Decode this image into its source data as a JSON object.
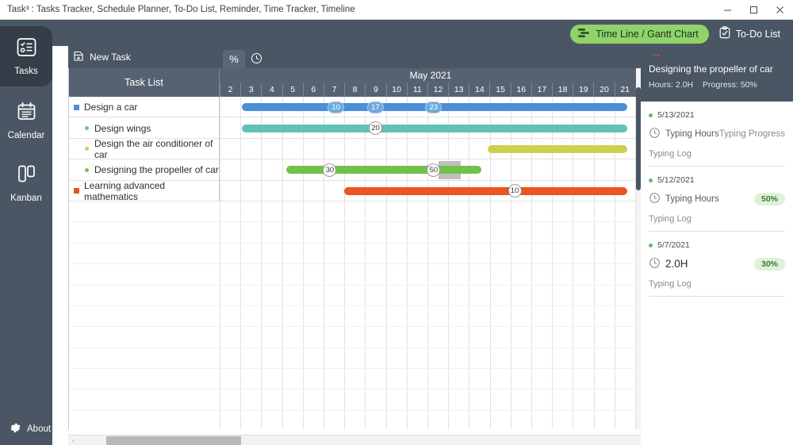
{
  "window": {
    "title": "Task³ : Tasks Tracker, Schedule Planner, To-Do List, Reminder, Time Tracker, Timeline",
    "minimize_icon": "minimize-icon",
    "maximize_icon": "maximize-icon",
    "close_icon": "close-icon"
  },
  "top_actions": {
    "gantt_label": "Time Line / Gantt Chart",
    "gantt_icon": "timeline-icon",
    "gantt_bg": "#8fd36a",
    "todo_label": "To-Do List",
    "todo_icon": "clipboard-check-icon"
  },
  "sidebar": {
    "items": [
      {
        "label": "Tasks",
        "icon": "tasks-checklist-icon",
        "active": true
      },
      {
        "label": "Calendar",
        "icon": "calendar-icon",
        "active": false
      },
      {
        "label": "Kanban",
        "icon": "kanban-columns-icon",
        "active": false
      }
    ],
    "about_label": "About",
    "about_icon": "gear-icon"
  },
  "toolbar": {
    "new_task_label": "New Task",
    "new_task_icon": "add-document-icon",
    "tabs": [
      {
        "glyph": "%",
        "name": "percent-tab",
        "selected": true
      },
      {
        "glyph": "clock",
        "name": "clock-tab",
        "selected": false
      }
    ]
  },
  "gantt": {
    "tasklist_header": "Task List",
    "month_header": "May 2021",
    "days": [
      "2",
      "3",
      "4",
      "5",
      "6",
      "7",
      "8",
      "9",
      "10",
      "11",
      "12",
      "13",
      "14",
      "15",
      "16",
      "17",
      "18",
      "19",
      "20",
      "21"
    ],
    "tasks": [
      {
        "name": "Design a car",
        "level": 0,
        "color": "#4a90d9",
        "bullet": "square"
      },
      {
        "name": "Design wings",
        "level": 1,
        "color": "#5fc2b4",
        "bullet": "dot"
      },
      {
        "name": "Design the air conditioner of car",
        "level": 1,
        "color": "#cdd04e",
        "bullet": "dot"
      },
      {
        "name": "Designing the propeller of car",
        "level": 1,
        "color": "#6fc24a",
        "bullet": "dot"
      },
      {
        "name": "Learning advanced mathematics",
        "level": 0,
        "color": "#ea5520",
        "bullet": "square"
      }
    ],
    "bars": [
      {
        "task": "Design a car",
        "color": "#4a90d9",
        "start_day": 3.05,
        "end_day": 21.6,
        "markers": [
          {
            "label": "10",
            "day": 7.6,
            "style": "blue"
          },
          {
            "label": "17",
            "day": 9.5,
            "style": "blue"
          },
          {
            "label": "23",
            "day": 12.3,
            "style": "blue"
          }
        ]
      },
      {
        "task": "Design wings",
        "color": "#5fc2b4",
        "start_day": 3.05,
        "end_day": 21.6,
        "markers": [
          {
            "label": "20",
            "day": 9.5,
            "style": "circle"
          }
        ]
      },
      {
        "task": "Design the air conditioner of car",
        "color": "#cdd04e",
        "start_day": 14.9,
        "end_day": 21.6,
        "markers": []
      },
      {
        "task": "Designing the propeller of car",
        "color": "#6fc24a",
        "start_day": 5.2,
        "end_day": 14.6,
        "markers": [
          {
            "label": "30",
            "day": 7.3,
            "style": "circle"
          },
          {
            "label": "50",
            "day": 12.3,
            "style": "circle"
          }
        ]
      },
      {
        "task": "Learning advanced mathematics",
        "color": "#ea5520",
        "start_day": 8.0,
        "end_day": 21.6,
        "markers": [
          {
            "label": "10",
            "day": 16.2,
            "style": "circle"
          }
        ]
      }
    ],
    "selection_block": {
      "row": 3,
      "start_day": 12.55,
      "end_day": 13.6,
      "color": "#bfbfbf"
    }
  },
  "right_panel": {
    "collapse_icon": "arrow-right-icon",
    "title": "Designing the propeller of car",
    "hours_label": "Hours: 2.0H",
    "progress_label": "Progress: 50%",
    "entries": [
      {
        "date": "5/13/2021",
        "hours_text": "Typing Hours",
        "hours_icon": "clock-icon",
        "progress_text": "Typing Progress",
        "progress_is_badge": false,
        "note": "Typing Log"
      },
      {
        "date": "5/12/2021",
        "hours_text": "Typing Hours",
        "hours_icon": "clock-icon",
        "progress_text": "50%",
        "progress_is_badge": true,
        "note": "Typing Log"
      },
      {
        "date": "5/7/2021",
        "hours_text": "2.0H",
        "hours_icon": "clock-icon",
        "progress_text": "30%",
        "progress_is_badge": true,
        "note": "Typing Log"
      }
    ]
  },
  "scrollbar": {
    "left_arrow": "‹",
    "name": "horizontal-scrollbar"
  }
}
